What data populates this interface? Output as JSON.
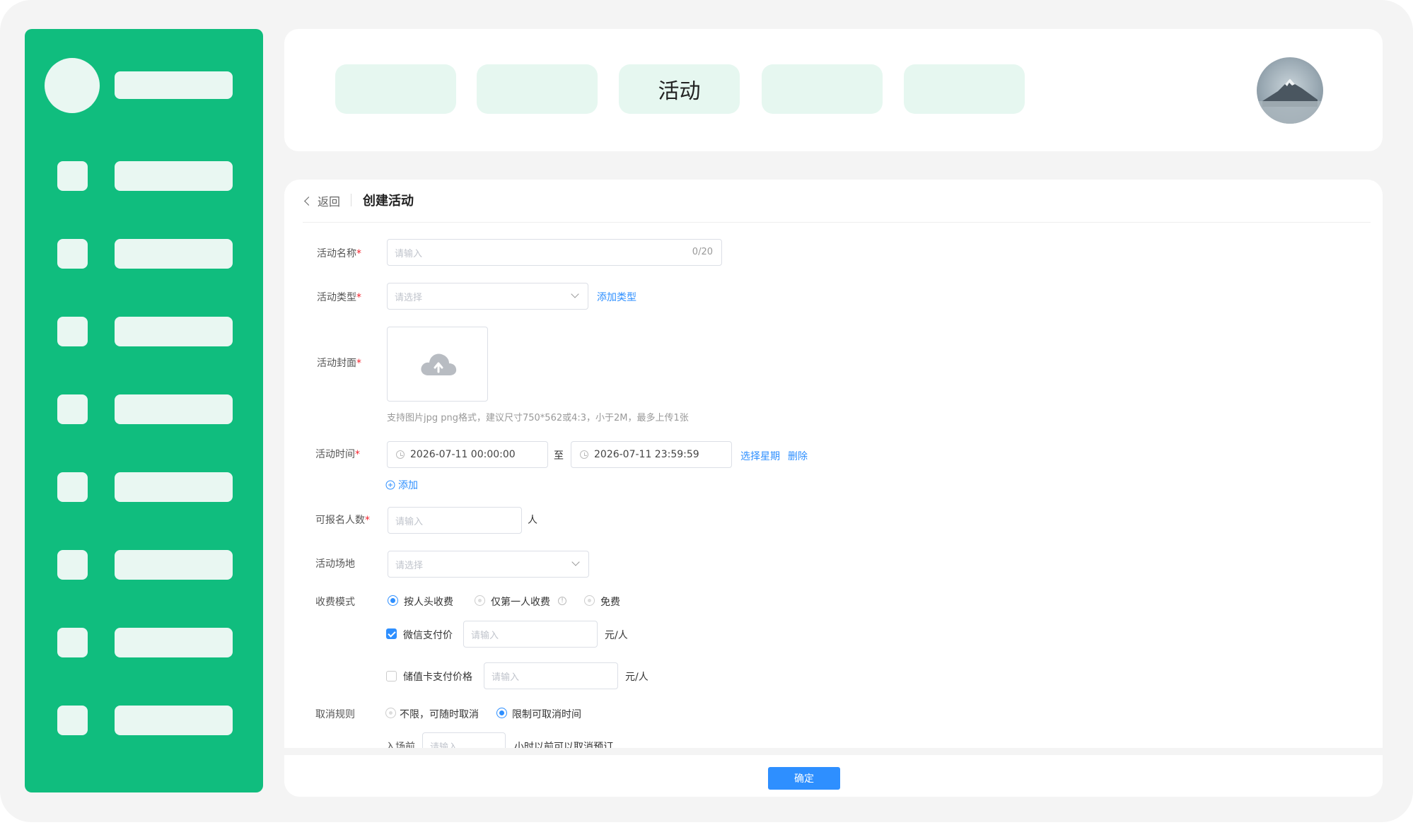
{
  "nav": {
    "tabs": [
      "",
      "",
      "活动",
      "",
      ""
    ]
  },
  "page": {
    "back_label": "返回",
    "title": "创建活动"
  },
  "form": {
    "name": {
      "label": "活动名称",
      "placeholder": "请输入",
      "counter": "0/20"
    },
    "type": {
      "label": "活动类型",
      "placeholder": "请选择",
      "add_link": "添加类型"
    },
    "cover": {
      "label": "活动封面",
      "hint": "支持图片jpg png格式，建议尺寸750*562或4:3，小于2M，最多上传1张"
    },
    "time": {
      "label": "活动时间",
      "start": "2026-07-11 00:00:00",
      "to": "至",
      "end": "2026-07-11 23:59:59",
      "select_week": "选择星期",
      "delete": "删除",
      "add": "添加"
    },
    "capacity": {
      "label": "可报名人数",
      "placeholder": "请输入",
      "unit": "人"
    },
    "venue": {
      "label": "活动场地",
      "placeholder": "请选择"
    },
    "fee": {
      "label": "收费模式",
      "options": [
        "按人头收费",
        "仅第一人收费",
        "免费"
      ],
      "selected": "按人头收费",
      "wechat": {
        "label": "微信支付价",
        "checked": true,
        "placeholder": "请输入",
        "unit": "元/人"
      },
      "card": {
        "label": "储值卡支付价格",
        "checked": false,
        "placeholder": "请输入",
        "unit": "元/人"
      }
    },
    "cancel": {
      "label": "取消规则",
      "options": [
        "不限，可随时取消",
        "限制可取消时间"
      ],
      "selected": "限制可取消时间",
      "prefix": "入场前",
      "placeholder": "请输入",
      "suffix": "小时以前可以取消预订"
    }
  },
  "footer": {
    "confirm_label": "确定"
  },
  "colors": {
    "sidebar": "#10bd7e",
    "pill": "#e6f7f0",
    "primary": "#2e8fff",
    "required": "#f5222d"
  }
}
